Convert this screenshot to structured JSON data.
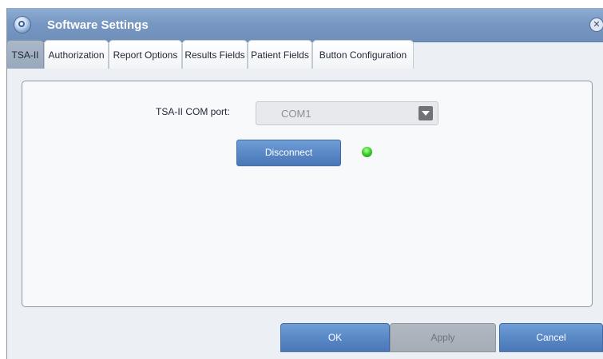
{
  "window": {
    "title": "Software Settings"
  },
  "tabs": [
    {
      "label": "TSA-II",
      "active": true
    },
    {
      "label": "Authorization",
      "active": false
    },
    {
      "label": "Report Options",
      "active": false
    },
    {
      "label": "Results Fields",
      "active": false
    },
    {
      "label": "Patient Fields",
      "active": false
    },
    {
      "label": "Button Configuration",
      "active": false
    }
  ],
  "tsa": {
    "com_port_label": "TSA-II COM port:",
    "com_port_value": "COM1",
    "disconnect_label": "Disconnect",
    "connection_status_color": "#3ed12c"
  },
  "footer": {
    "ok_label": "OK",
    "apply_label": "Apply",
    "cancel_label": "Cancel"
  },
  "icons": {
    "app": "app-logo-icon",
    "close": "close-icon",
    "dropdown": "chevron-down-icon"
  }
}
